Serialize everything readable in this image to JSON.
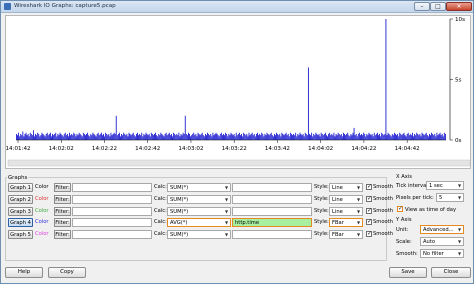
{
  "window": {
    "title": "Wireshark IO Graphs: capture5.pcap",
    "min_glyph": "–",
    "max_glyph": "□",
    "close_glyph": "✕"
  },
  "chart_data": {
    "type": "bar",
    "xlabel": "",
    "ylabel": "",
    "x_tick_labels": [
      "14:01:42",
      "14:02:02",
      "14:02:22",
      "14:02:42",
      "14:03:02",
      "14:03:22",
      "14:03:42",
      "14:04:02",
      "14:04:22",
      "14:04:42"
    ],
    "y_tick_labels": [
      "10s",
      "5s",
      "0s"
    ],
    "ylim": [
      0,
      10
    ],
    "grid": false,
    "color": "#1f1fd0",
    "series": [
      {
        "values": [
          0.5,
          0.4,
          0.6,
          0.3,
          0.5,
          0.4,
          0.7,
          0.3,
          0.5,
          0.6,
          0.4,
          0.5,
          0.3,
          0.6,
          0.5,
          0.4,
          0.8,
          0.3,
          0.5,
          0.4,
          0.6,
          0.5,
          0.3,
          0.4,
          0.6,
          0.5,
          0.4,
          0.3,
          0.5,
          0.6,
          0.4,
          0.5,
          0.6,
          0.3,
          0.5,
          0.4,
          0.5,
          0.6,
          0.3,
          0.5,
          0.4,
          0.6,
          0.5,
          0.4,
          0.3,
          0.5,
          0.6,
          0.4,
          0.5,
          0.3,
          0.6,
          0.4,
          0.5,
          0.4,
          0.6,
          0.5,
          0.3,
          0.5,
          0.4,
          0.6,
          0.5,
          0.4,
          0.3,
          0.6,
          0.5,
          0.4,
          0.5,
          0.6,
          0.4,
          0.3,
          0.5,
          0.4,
          0.6,
          0.5,
          0.4,
          0.3,
          0.5,
          0.6,
          0.4,
          0.5,
          0.6,
          0.4,
          0.5,
          0.3,
          0.6,
          0.5,
          0.4,
          0.5,
          0.3,
          0.6,
          0.4,
          0.5,
          0.6,
          0.5,
          2.0,
          0.4,
          0.5,
          0.6,
          0.3,
          0.5,
          0.4,
          0.6,
          0.5,
          0.4,
          0.5,
          0.3,
          0.6,
          0.5,
          0.4,
          0.5,
          0.6,
          0.4,
          0.3,
          0.5,
          0.6,
          0.4,
          0.5,
          0.4,
          0.6,
          0.3,
          0.5,
          0.4,
          0.6,
          0.5,
          0.4,
          0.5,
          0.3,
          0.6,
          0.5,
          0.4,
          0.5,
          0.6,
          0.4,
          0.3,
          0.5,
          0.4,
          0.6,
          0.5,
          0.4,
          0.3,
          0.5,
          0.6,
          0.4,
          0.5,
          0.6,
          0.4,
          0.5,
          0.3,
          0.6,
          0.5,
          0.4,
          0.5,
          0.4,
          0.6,
          0.3,
          0.5,
          0.4,
          0.6,
          0.5,
          2.0,
          0.5,
          0.4,
          0.6,
          0.5,
          0.3,
          0.4,
          0.5,
          0.6,
          0.4,
          0.5,
          0.3,
          0.6,
          0.5,
          0.4,
          0.5,
          0.6,
          0.4,
          0.3,
          0.5,
          0.4,
          0.6,
          0.5,
          0.4,
          0.5,
          0.3,
          0.6,
          0.4,
          0.5,
          0.6,
          0.5,
          0.4,
          0.3,
          0.5,
          0.6,
          0.4,
          0.5,
          0.4,
          0.6,
          0.5,
          0.3,
          0.5,
          0.4,
          0.6,
          0.5,
          0.4,
          0.5,
          0.3,
          0.6,
          0.4,
          0.5,
          0.6,
          0.4,
          0.5,
          0.3,
          0.6,
          0.5,
          0.4,
          0.5,
          0.3,
          0.6,
          0.4,
          0.5,
          0.6,
          0.4,
          0.5,
          0.3,
          0.5,
          0.6,
          0.4,
          0.5,
          0.4,
          0.6,
          0.5,
          0.3,
          0.5,
          0.4,
          0.6,
          0.5,
          0.4,
          0.5,
          0.6,
          0.4,
          0.3,
          0.5,
          0.4,
          0.6,
          0.5,
          0.4,
          0.5,
          0.3,
          0.6,
          0.5,
          0.4,
          0.5,
          0.6,
          0.4,
          0.5,
          0.3,
          0.6,
          0.5,
          0.4,
          0.5,
          0.4,
          0.6,
          0.3,
          0.5,
          0.4,
          0.6,
          0.5,
          0.4,
          0.5,
          0.3,
          0.6,
          0.5,
          0.4,
          6.0,
          0.5,
          0.4,
          0.6,
          0.3,
          0.5,
          0.4,
          0.6,
          0.5,
          0.4,
          0.5,
          0.3,
          0.6,
          0.5,
          0.4,
          0.5,
          0.6,
          0.4,
          0.3,
          0.5,
          0.6,
          0.4,
          0.5,
          0.4,
          0.6,
          0.3,
          0.5,
          0.4,
          0.6,
          0.5,
          0.4,
          0.5,
          0.3,
          0.6,
          0.5,
          0.4,
          0.5,
          0.6,
          0.4,
          0.3,
          0.5,
          0.4,
          0.6,
          1.0,
          0.4,
          0.5,
          0.3,
          0.5,
          0.6,
          0.4,
          0.5,
          0.4,
          0.6,
          0.5,
          0.3,
          0.5,
          0.4,
          0.6,
          0.5,
          0.4,
          0.5,
          0.3,
          0.6,
          0.4,
          0.5,
          0.6,
          0.4,
          0.5,
          0.3,
          0.6,
          0.5,
          0.4,
          0.5,
          10.0,
          0.4,
          0.6,
          0.5,
          0.4,
          0.3,
          0.5,
          0.4,
          0.6,
          0.5,
          0.4,
          0.5,
          0.3,
          0.6,
          0.5,
          0.4,
          0.5,
          0.6,
          0.4,
          0.3,
          0.5,
          0.6,
          0.4,
          0.5,
          0.4,
          0.6,
          0.3,
          0.5,
          0.4,
          0.6,
          0.5,
          0.4,
          0.5,
          0.3,
          0.6,
          0.5,
          0.4,
          0.5,
          0.6,
          0.4,
          0.3,
          0.5,
          0.4,
          0.6,
          0.5,
          0.4,
          0.5,
          0.3,
          0.6,
          0.4,
          0.5,
          0.6,
          0.4,
          0.5,
          0.3,
          0.6,
          0.5
        ]
      }
    ]
  },
  "graphs": {
    "label": "Graphs",
    "color_label": "Color",
    "filter_label": "Filter:",
    "calc_label": "Calc:",
    "style_label": "Style:",
    "smooth_label": "Smooth",
    "rows": [
      {
        "button": "Graph 1",
        "color": "#000000",
        "filter": "",
        "calc": "SUM(*)",
        "field": "",
        "style": "Line",
        "smooth": true,
        "active": false
      },
      {
        "button": "Graph 2",
        "color": "#e03030",
        "filter": "",
        "calc": "SUM(*)",
        "field": "",
        "style": "Line",
        "smooth": true,
        "active": false
      },
      {
        "button": "Graph 3",
        "color": "#3aa83a",
        "filter": "",
        "calc": "SUM(*)",
        "field": "",
        "style": "Line",
        "smooth": true,
        "active": false
      },
      {
        "button": "Graph 4",
        "color": "#3030e0",
        "filter": "",
        "calc": "AVG(*)",
        "field": "http.time",
        "style": "FBar",
        "smooth": true,
        "active": true
      },
      {
        "button": "Graph 5",
        "color": "#e040e0",
        "filter": "",
        "calc": "SUM(*)",
        "field": "",
        "style": "FBar",
        "smooth": true,
        "active": false
      }
    ]
  },
  "x_axis": {
    "head": "X Axis",
    "tick_interval_label": "Tick interval:",
    "tick_interval_value": "1 sec",
    "pixels_label": "Pixels per tick:",
    "pixels_value": "5",
    "view_time_label": "View as time of day",
    "view_time_checked": true
  },
  "y_axis": {
    "head": "Y Axis",
    "unit_label": "Unit:",
    "unit_value": "Advanced...",
    "scale_label": "Scale:",
    "scale_value": "Auto",
    "smooth_label": "Smooth:",
    "smooth_value": "No filter"
  },
  "footer": {
    "help": "Help",
    "copy": "Copy",
    "save": "Save",
    "close": "Close"
  }
}
